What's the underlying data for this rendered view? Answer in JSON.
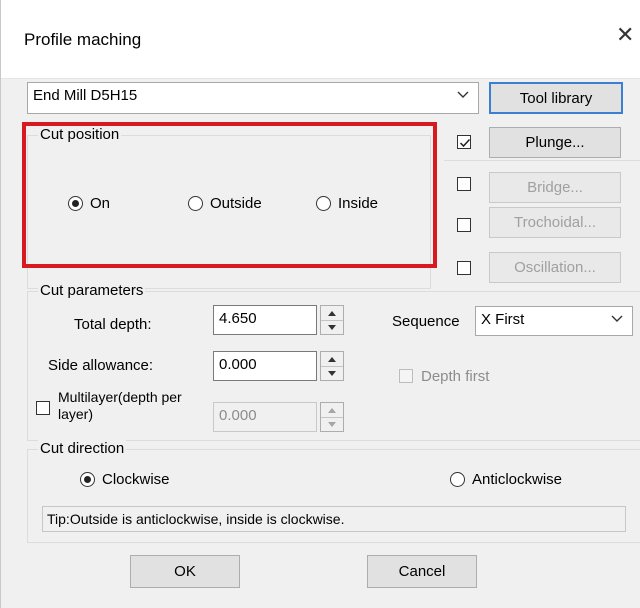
{
  "window": {
    "title": "Profile maching",
    "close_symbol": "✕"
  },
  "tool": {
    "selected": "End Mill D5H15",
    "library_button": "Tool library"
  },
  "cut_position": {
    "legend": "Cut position",
    "options": [
      "On",
      "Outside",
      "Inside"
    ],
    "selected": "On"
  },
  "side_options": {
    "plunge": {
      "label": "Plunge...",
      "checked": true,
      "enabled": true
    },
    "bridge": {
      "label": "Bridge...",
      "checked": false,
      "enabled": false
    },
    "trochoidal": {
      "label": "Trochoidal...",
      "checked": false,
      "enabled": false
    },
    "oscillation": {
      "label": "Oscillation...",
      "checked": false,
      "enabled": false
    }
  },
  "cut_parameters": {
    "legend": "Cut parameters",
    "total_depth": {
      "label": "Total depth:",
      "value": "4.650"
    },
    "side_allowance": {
      "label": "Side allowance:",
      "value": "0.000"
    },
    "multilayer": {
      "label_line1": "Multilayer(depth per",
      "label_line2": "layer)",
      "value": "0.000",
      "checked": false
    },
    "sequence": {
      "label": "Sequence",
      "value": "X First"
    },
    "depth_first": {
      "label": "Depth first",
      "checked": false
    }
  },
  "cut_direction": {
    "legend": "Cut direction",
    "options": [
      "Clockwise",
      "Anticlockwise"
    ],
    "selected": "Clockwise"
  },
  "tip": "Tip:Outside is anticlockwise, inside is clockwise.",
  "buttons": {
    "ok": "OK",
    "cancel": "Cancel"
  },
  "colors": {
    "highlight": "#d71920",
    "default_button_border": "#3c7fd0"
  }
}
